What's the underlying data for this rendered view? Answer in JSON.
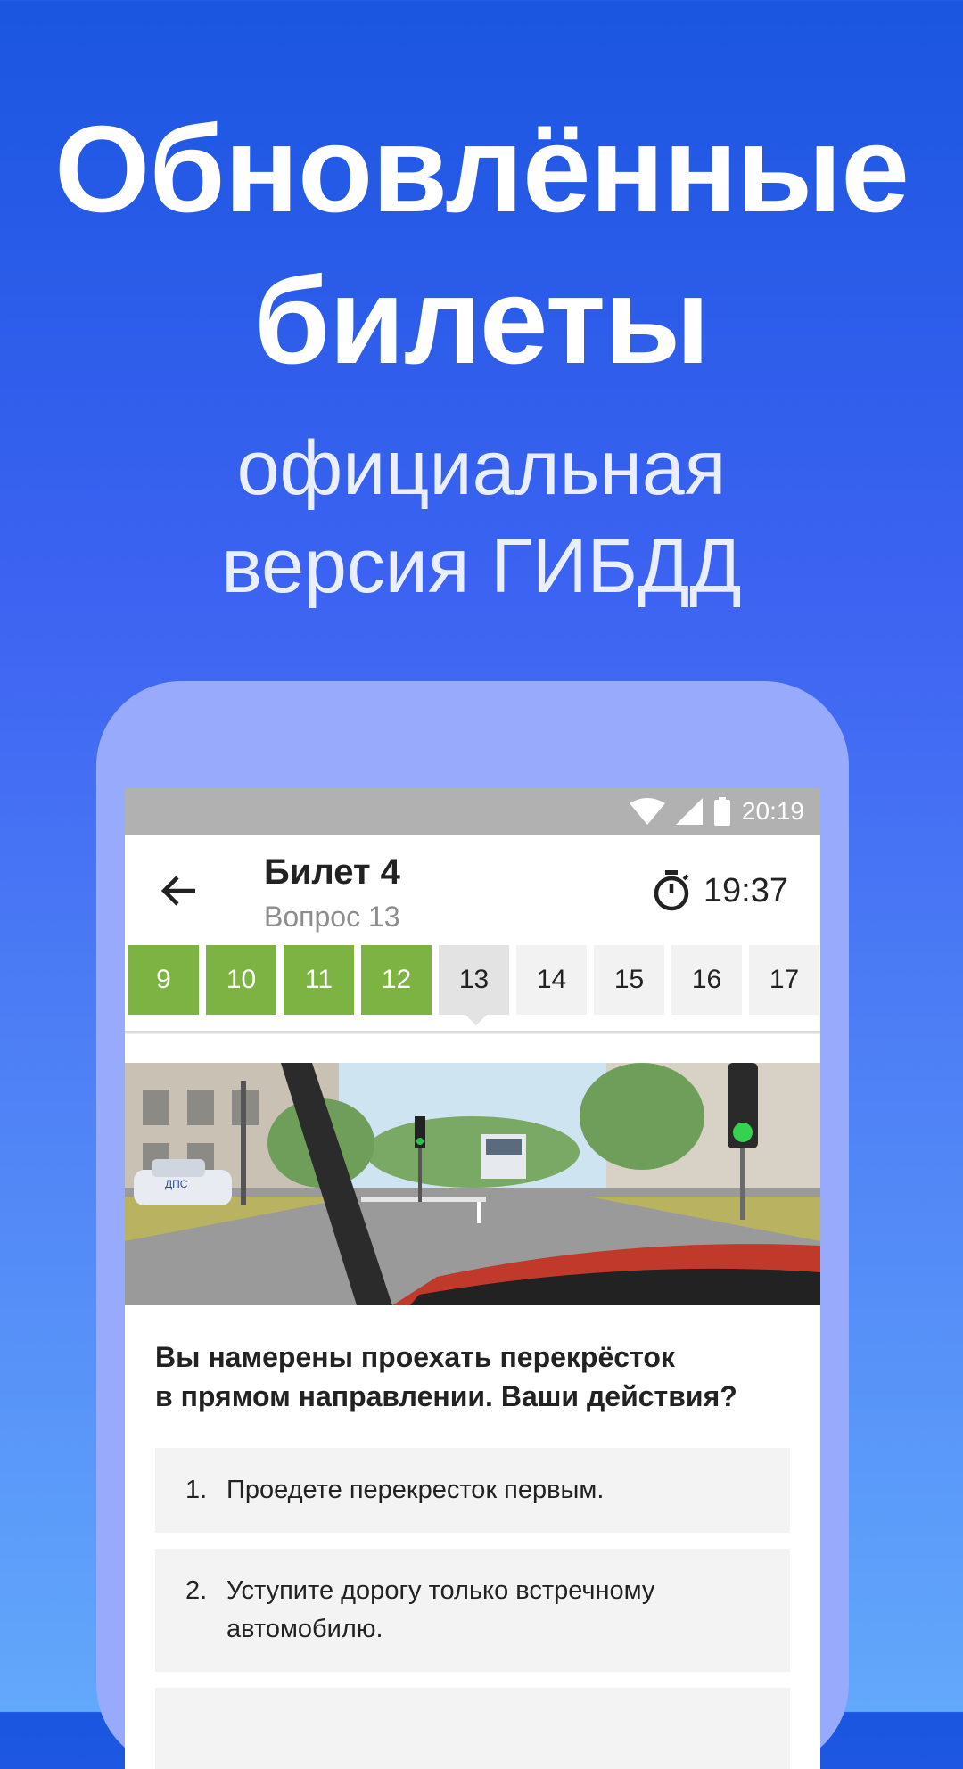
{
  "promo": {
    "title_line1": "Обновлённые",
    "title_line2": "билеты",
    "subtitle_line1": "официальная",
    "subtitle_line2": "версия ГИБДД"
  },
  "statusbar": {
    "time": "20:19",
    "icons": [
      "wifi-icon",
      "signal-icon",
      "battery-icon"
    ]
  },
  "appbar": {
    "title": "Билет 4",
    "subtitle": "Вопрос 13",
    "timer": "19:37",
    "back_icon": "arrow-left-icon",
    "timer_icon": "stopwatch-icon"
  },
  "question_nav": [
    {
      "label": "9",
      "state": "answered"
    },
    {
      "label": "10",
      "state": "answered"
    },
    {
      "label": "11",
      "state": "answered"
    },
    {
      "label": "12",
      "state": "answered"
    },
    {
      "label": "13",
      "state": "current"
    },
    {
      "label": "14",
      "state": "pending"
    },
    {
      "label": "15",
      "state": "pending"
    },
    {
      "label": "16",
      "state": "pending"
    },
    {
      "label": "17",
      "state": "pending"
    }
  ],
  "question": {
    "line1": "Вы намерены проехать перекрёсток",
    "line2": "в прямом направлении. Ваши действия?",
    "scene_sign": "ДПС"
  },
  "answers": [
    {
      "num": "1.",
      "text": "Проедете перекресток первым."
    },
    {
      "num": "2.",
      "text_line1": "Уступите дорогу только встречному",
      "text_line2": "автомобилю."
    }
  ],
  "colors": {
    "answered": "#7cb342",
    "current": "#e3e3e3",
    "pending": "#f2f2f2",
    "bg_top": "#1a56e0",
    "bg_bottom": "#62a8fb"
  }
}
